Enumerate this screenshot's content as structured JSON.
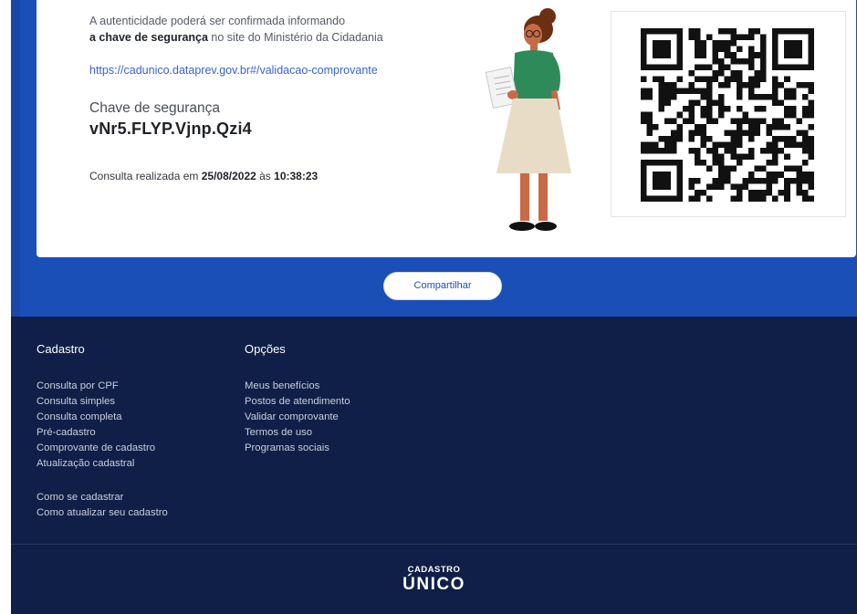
{
  "certificate": {
    "auth_line1": "A autenticidade poderá ser confirmada informando",
    "auth_bold": "a chave de segurança",
    "auth_rest": " no site do Ministério da Cidadania",
    "link": "https://cadunico.dataprev.gov.br#/validacao-comprovante",
    "key_label": "Chave de segurança",
    "key_value": "vNr5.FLYP.Vjnp.Qzi4",
    "consulta_prefix": "Consulta realizada em ",
    "consulta_date": "25/08/2022",
    "consulta_sep": " às ",
    "consulta_time": "10:38:23"
  },
  "actions": {
    "share_label": "Compartilhar"
  },
  "footer": {
    "cadastro": {
      "title": "Cadastro",
      "items": [
        "Consulta por CPF",
        "Consulta simples",
        "Consulta completa",
        "Pré-cadastro",
        "Comprovante de cadastro",
        "Atualização cadastral"
      ],
      "extra": [
        "Como se cadastrar",
        "Como atualizar seu cadastro"
      ]
    },
    "opcoes": {
      "title": "Opções",
      "items": [
        "Meus benefícios",
        "Postos de atendimento",
        "Validar comprovante",
        "Termos de uso",
        "Programas sociais"
      ]
    },
    "logo_top": "CADASTRO",
    "logo_main": "ÚNICO"
  },
  "colors": {
    "brand_blue": "#1a4fb8",
    "footer_navy": "#0f1f47",
    "link_blue": "#3a64c8"
  },
  "icons": {
    "illustration": "woman-holding-document-illustration",
    "qr": "qr-code"
  }
}
